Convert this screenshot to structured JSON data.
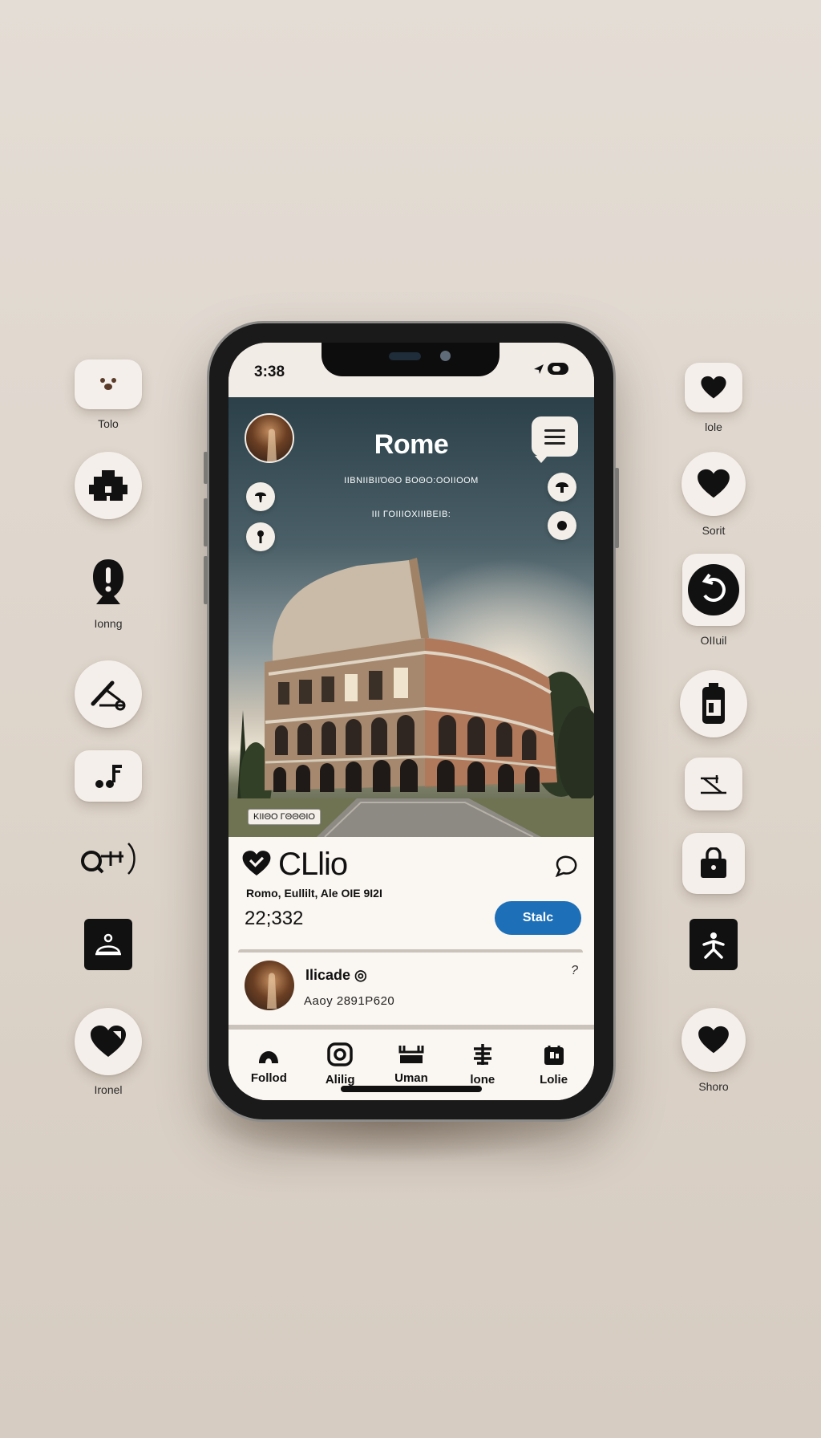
{
  "status_bar": {
    "time": "3:38"
  },
  "hero": {
    "title": "Rome",
    "subtitle_line1": "ΙΙΒΝΙΙΒΙΙΌΘΟ ΒΟΘΟ:ΟΟΙΙΟΟΜ",
    "subtitle_line2": "ΙΙΙ ΓΟΙΙΙΟΧΙΙΙΒΕΙΒ:",
    "photo_tag": "ΚΙΙΘΟ ΓΘΘΘΙΟ"
  },
  "card": {
    "title": "CLlio",
    "meta": "Romo, Eullilt, Ale OIE 9I2I",
    "count": "22;332",
    "button_label": "Stalc"
  },
  "comment": {
    "name": "Ilicade ◎",
    "subtitle": "Aaoy 2891P620",
    "more": "?"
  },
  "tabs": [
    {
      "label": "Follod",
      "icon": "pin-icon"
    },
    {
      "label": "Alilig",
      "icon": "camera-icon"
    },
    {
      "label": "Uman",
      "icon": "basket-icon"
    },
    {
      "label": "lone",
      "icon": "book-icon"
    },
    {
      "label": "Lolie",
      "icon": "bag-icon"
    }
  ],
  "left_icons": [
    {
      "label": "Tolo",
      "icon": "dog-face-icon"
    },
    {
      "label": "",
      "icon": "puzzle-icon"
    },
    {
      "label": "Ionng",
      "icon": "alert-bubble-icon"
    },
    {
      "label": "",
      "icon": "scissors-icon"
    },
    {
      "label": "",
      "icon": "music-icon"
    },
    {
      "label": "",
      "icon": "search-link-icon"
    },
    {
      "label": "",
      "icon": "bell-icon"
    },
    {
      "label": "Ironel",
      "icon": "heart-icon"
    }
  ],
  "right_icons": [
    {
      "label": "lole",
      "icon": "heart-icon"
    },
    {
      "label": "Sorit",
      "icon": "heart-icon"
    },
    {
      "label": "OIIuil",
      "icon": "refresh-icon"
    },
    {
      "label": "",
      "icon": "battery-icon"
    },
    {
      "label": "",
      "icon": "chart-icon"
    },
    {
      "label": "",
      "icon": "bag-icon"
    },
    {
      "label": "",
      "icon": "person-icon"
    },
    {
      "label": "Shoro",
      "icon": "heart-icon"
    }
  ],
  "colors": {
    "accent": "#1d6fb8",
    "background": "#ddd4ca",
    "surface": "#faf6f1"
  }
}
